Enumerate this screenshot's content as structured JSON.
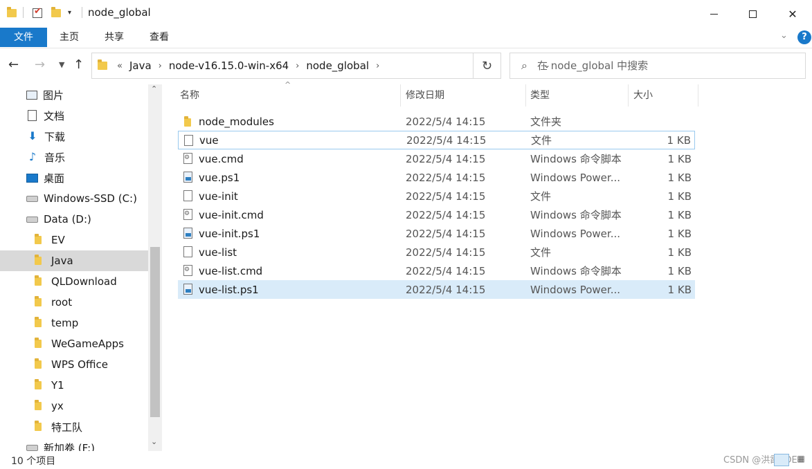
{
  "window": {
    "title": "node_global"
  },
  "ribbon": {
    "tabs": [
      "文件",
      "主页",
      "共享",
      "查看"
    ]
  },
  "address": {
    "overflow": "«",
    "crumbs": [
      "Java",
      "node-v16.15.0-win-x64",
      "node_global"
    ]
  },
  "search": {
    "placeholder": "在 node_global 中搜索"
  },
  "sidebar": {
    "items": [
      {
        "label": "图片",
        "icon": "pictures-icon"
      },
      {
        "label": "文档",
        "icon": "documents-icon"
      },
      {
        "label": "下载",
        "icon": "downloads-icon"
      },
      {
        "label": "音乐",
        "icon": "music-icon"
      },
      {
        "label": "桌面",
        "icon": "desktop-icon"
      },
      {
        "label": "Windows-SSD (C:)",
        "icon": "drive-icon"
      },
      {
        "label": "Data (D:)",
        "icon": "drive-icon"
      },
      {
        "label": "EV",
        "icon": "folder-icon"
      },
      {
        "label": "Java",
        "icon": "folder-icon",
        "selected": true
      },
      {
        "label": "QLDownload",
        "icon": "folder-icon"
      },
      {
        "label": "root",
        "icon": "folder-icon"
      },
      {
        "label": "temp",
        "icon": "folder-icon"
      },
      {
        "label": "WeGameApps",
        "icon": "folder-icon"
      },
      {
        "label": "WPS Office",
        "icon": "folder-icon"
      },
      {
        "label": "Y1",
        "icon": "folder-icon"
      },
      {
        "label": "yx",
        "icon": "folder-icon"
      },
      {
        "label": "特工队",
        "icon": "folder-icon"
      },
      {
        "label": "新加卷 (F:)",
        "icon": "drive-icon"
      }
    ]
  },
  "columns": {
    "name": "名称",
    "date": "修改日期",
    "type": "类型",
    "size": "大小"
  },
  "files": [
    {
      "name": "node_modules",
      "date": "2022/5/4 14:15",
      "type": "文件夹",
      "size": "",
      "icon": "folder-icon"
    },
    {
      "name": "vue",
      "date": "2022/5/4 14:15",
      "type": "文件",
      "size": "1 KB",
      "icon": "file-icon"
    },
    {
      "name": "vue.cmd",
      "date": "2022/5/4 14:15",
      "type": "Windows 命令脚本",
      "size": "1 KB",
      "icon": "cmd-file-icon"
    },
    {
      "name": "vue.ps1",
      "date": "2022/5/4 14:15",
      "type": "Windows Power...",
      "size": "1 KB",
      "icon": "powershell-file-icon"
    },
    {
      "name": "vue-init",
      "date": "2022/5/4 14:15",
      "type": "文件",
      "size": "1 KB",
      "icon": "file-icon"
    },
    {
      "name": "vue-init.cmd",
      "date": "2022/5/4 14:15",
      "type": "Windows 命令脚本",
      "size": "1 KB",
      "icon": "cmd-file-icon"
    },
    {
      "name": "vue-init.ps1",
      "date": "2022/5/4 14:15",
      "type": "Windows Power...",
      "size": "1 KB",
      "icon": "powershell-file-icon"
    },
    {
      "name": "vue-list",
      "date": "2022/5/4 14:15",
      "type": "文件",
      "size": "1 KB",
      "icon": "file-icon"
    },
    {
      "name": "vue-list.cmd",
      "date": "2022/5/4 14:15",
      "type": "Windows 命令脚本",
      "size": "1 KB",
      "icon": "cmd-file-icon"
    },
    {
      "name": "vue-list.ps1",
      "date": "2022/5/4 14:15",
      "type": "Windows Power...",
      "size": "1 KB",
      "icon": "powershell-file-icon"
    }
  ],
  "status": {
    "count": "10 个项目"
  },
  "watermark": "CSDN @洪霞3DE",
  "colors": {
    "accent": "#1979ca",
    "selection": "#d9ebf9",
    "sidebar_selected": "#d9d9d9"
  }
}
